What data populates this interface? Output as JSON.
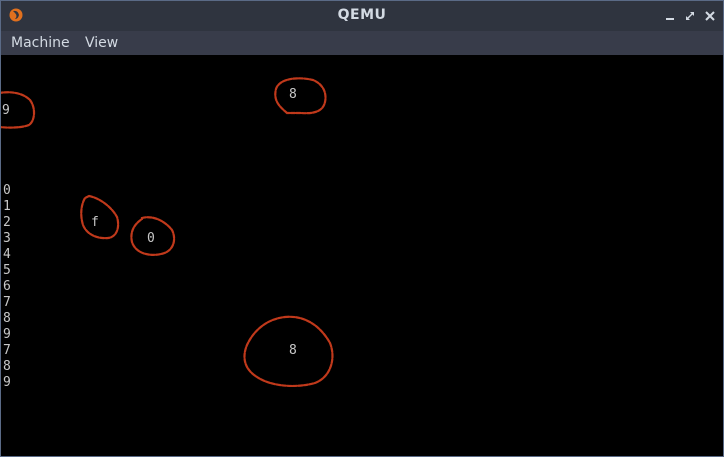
{
  "window": {
    "title": "QEMU",
    "app_icon": "qemu-app-icon",
    "buttons": [
      "minimize-icon",
      "maximize-icon",
      "close-icon"
    ]
  },
  "menubar": {
    "items": [
      {
        "label": "Machine"
      },
      {
        "label": "View"
      }
    ]
  },
  "screen": {
    "background": "#000000",
    "outline_color": "#c0391b",
    "labeled_blobs": [
      {
        "label": "9"
      },
      {
        "label": "8"
      },
      {
        "label": "f"
      },
      {
        "label": "0"
      },
      {
        "label": "8"
      }
    ],
    "digit_column": [
      "0",
      "1",
      "2",
      "3",
      "4",
      "5",
      "6",
      "7",
      "8",
      "9",
      "7",
      "8",
      "9"
    ]
  }
}
